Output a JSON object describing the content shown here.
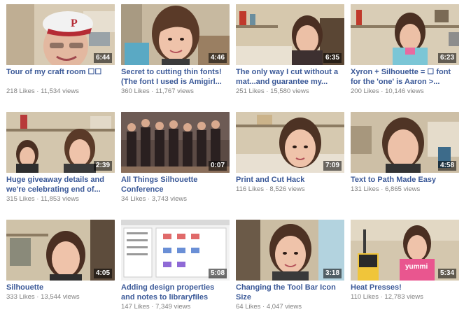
{
  "videos": [
    {
      "title": "Tour of my craft room ☐☐",
      "duration": "6:44",
      "likes": "218 Likes",
      "views": "11,534 views"
    },
    {
      "title": "Secret to cutting thin fonts! (The font I used is Amigirl...",
      "duration": "4:46",
      "likes": "360 Likes",
      "views": "11,767 views"
    },
    {
      "title": "The only way I cut without a mat...and guarantee my...",
      "duration": "6:35",
      "likes": "251 Likes",
      "views": "15,580 views"
    },
    {
      "title": "Xyron + Silhouette = ☐ font for the 'one' is Aaron >...",
      "duration": "6:23",
      "likes": "200 Likes",
      "views": "10,146 views"
    },
    {
      "title": "Huge giveaway details and we're celebrating end of...",
      "duration": "2:39",
      "likes": "315 Likes",
      "views": "11,853 views"
    },
    {
      "title": "All Things Silhouette Conference",
      "duration": "0:07",
      "likes": "34 Likes",
      "views": "3,743 views"
    },
    {
      "title": "Print and Cut Hack",
      "duration": "7:09",
      "likes": "116 Likes",
      "views": "8,526 views"
    },
    {
      "title": "Text to Path Made Easy",
      "duration": "4:58",
      "likes": "131 Likes",
      "views": "6,865 views"
    },
    {
      "title": "Silhouette",
      "duration": "4:05",
      "likes": "333 Likes",
      "views": "13,544 views"
    },
    {
      "title": "Adding design properties and notes to libraryfiles",
      "duration": "5:08",
      "likes": "147 Likes",
      "views": "7,349 views"
    },
    {
      "title": "Changing the Tool Bar Icon Size",
      "duration": "3:18",
      "likes": "64 Likes",
      "views": "4,047 views"
    },
    {
      "title": "Heat Presses!",
      "duration": "5:34",
      "likes": "110 Likes",
      "views": "12,783 views"
    }
  ],
  "separator": " · ",
  "colors": {
    "title": "#3b5998",
    "meta": "#7f7f7f",
    "duration_text": "#ffffff"
  }
}
